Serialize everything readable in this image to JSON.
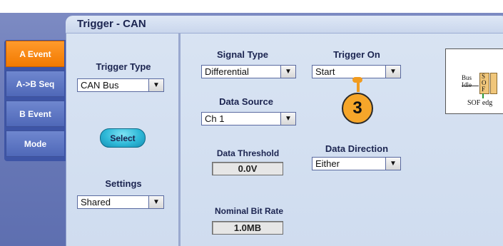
{
  "title": "Trigger - CAN",
  "tabs": [
    {
      "label": "A Event",
      "active": true
    },
    {
      "label": "A->B Seq",
      "active": false
    },
    {
      "label": "B Event",
      "active": false
    },
    {
      "label": "Mode",
      "active": false
    }
  ],
  "trigger_type": {
    "label": "Trigger Type",
    "value": "CAN Bus"
  },
  "select_button": {
    "label": "Select"
  },
  "settings": {
    "label": "Settings",
    "value": "Shared"
  },
  "signal_type": {
    "label": "Signal Type",
    "value": "Differential"
  },
  "data_source": {
    "label": "Data Source",
    "value": "Ch 1"
  },
  "data_threshold": {
    "label": "Data Threshold",
    "value": "0.0V"
  },
  "nominal_bit_rate": {
    "label": "Nominal Bit Rate",
    "value": "1.0MB"
  },
  "trigger_on": {
    "label": "Trigger On",
    "value": "Start"
  },
  "data_direction": {
    "label": "Data Direction",
    "value": "Either"
  },
  "callout": {
    "number": "3",
    "color": "#f6a62a"
  },
  "diagram": {
    "bus": "Bus",
    "idle": "Idle",
    "sof_s": "S",
    "sof_o": "O",
    "sof_f": "F",
    "caption": "SOF edg"
  },
  "colors": {
    "active_tab": "#f27a00",
    "tab": "#4f68b8",
    "panel": "#d9e4f3"
  }
}
